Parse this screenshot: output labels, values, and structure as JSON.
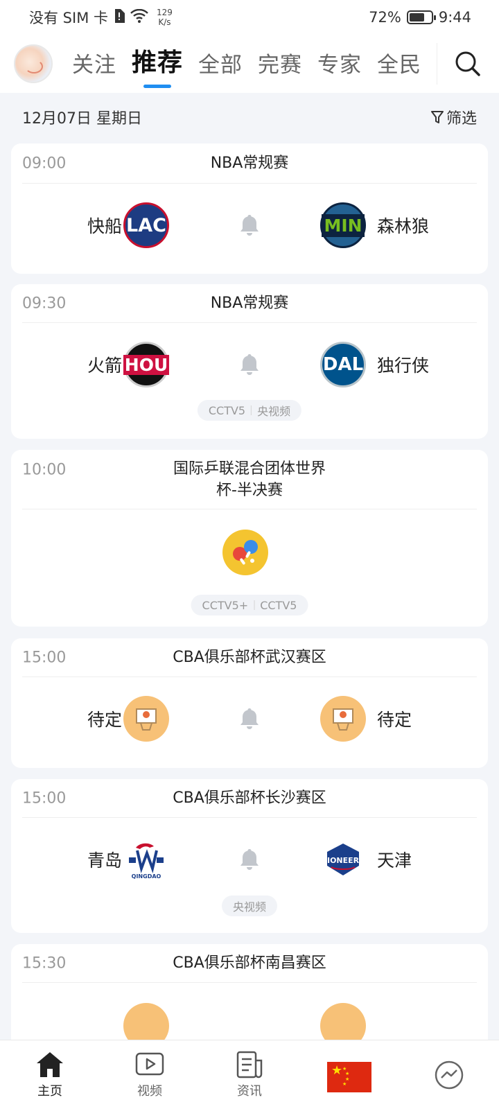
{
  "status_bar": {
    "carrier": "没有 SIM 卡",
    "speed_value": "129",
    "speed_unit": "K/s",
    "battery": "72%",
    "battery_level": 0.72,
    "time": "9:44"
  },
  "top_nav": {
    "tabs": [
      {
        "label": "关注",
        "active": false
      },
      {
        "label": "推荐",
        "active": true
      },
      {
        "label": "全部",
        "active": false
      },
      {
        "label": "完赛",
        "active": false
      },
      {
        "label": "专家",
        "active": false
      },
      {
        "label": "全民",
        "active": false
      }
    ],
    "search_icon": "search-icon"
  },
  "date_row": {
    "date": "12月07日 星期日",
    "filter_label": "筛选"
  },
  "matches": [
    {
      "time": "09:00",
      "title": "NBA常规赛",
      "home": "快船",
      "home_logo": "LAC",
      "away": "森林狼",
      "away_logo": "MIN",
      "channels": []
    },
    {
      "time": "09:30",
      "title": "NBA常规赛",
      "home": "火箭",
      "home_logo": "HOU",
      "away": "独行侠",
      "away_logo": "DAL",
      "channels": [
        "CCTV5",
        "央视频"
      ]
    },
    {
      "time": "10:00",
      "title_line1": "国际乒联混合团体世界",
      "title_line2": "杯-半决赛",
      "channels": [
        "CCTV5+",
        "CCTV5"
      ]
    },
    {
      "time": "15:00",
      "title": "CBA俱乐部杯武汉赛区",
      "home": "待定",
      "away": "待定",
      "channels": []
    },
    {
      "time": "15:00",
      "title": "CBA俱乐部杯长沙赛区",
      "home": "青岛",
      "home_logo": "QINGDAO",
      "away": "天津",
      "away_logo": "PIONEERS",
      "channels": [
        "央视频"
      ]
    },
    {
      "time": "15:30",
      "title": "CBA俱乐部杯南昌赛区"
    }
  ],
  "bottom_nav": {
    "items": [
      {
        "label": "主页",
        "icon": "home-icon",
        "active": true
      },
      {
        "label": "视频",
        "icon": "video-icon",
        "active": false
      },
      {
        "label": "资讯",
        "icon": "news-icon",
        "active": false
      },
      {
        "label": "",
        "icon": "china-flag-icon",
        "active": false
      },
      {
        "label": "",
        "icon": "messenger-icon",
        "active": false
      }
    ]
  },
  "colors": {
    "accent": "#1f8ef1",
    "background": "#f3f5f9"
  }
}
